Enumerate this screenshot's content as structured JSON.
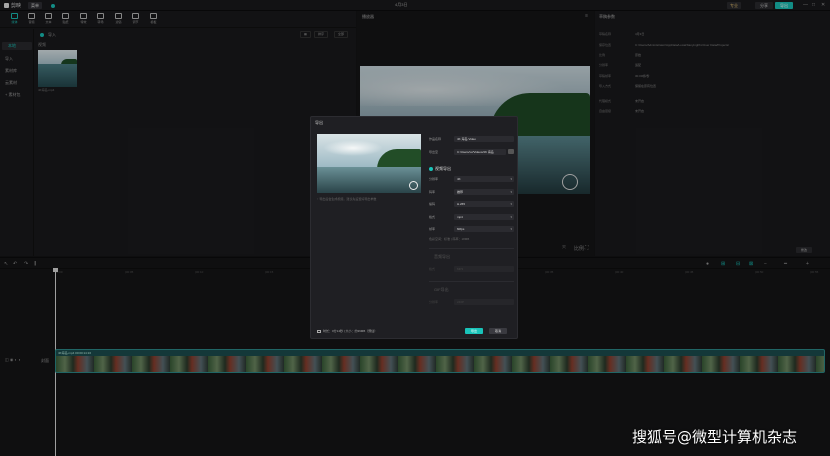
{
  "titlebar": {
    "app_name": "剪映",
    "menu_label": "菜单",
    "project_name": "",
    "center_time": "4月3日",
    "pro_label": "专业",
    "share_label": "分享",
    "export_label": "导出",
    "window_controls": [
      "—",
      "□",
      "✕"
    ]
  },
  "media_panel": {
    "tools": [
      {
        "label": "媒体",
        "icon": "media-icon"
      },
      {
        "label": "音频",
        "icon": "audio-icon"
      },
      {
        "label": "文本",
        "icon": "text-icon"
      },
      {
        "label": "贴纸",
        "icon": "sticker-icon"
      },
      {
        "label": "特效",
        "icon": "effects-icon"
      },
      {
        "label": "转场",
        "icon": "transition-icon"
      },
      {
        "label": "滤镜",
        "icon": "filter-icon"
      },
      {
        "label": "调节",
        "icon": "adjust-icon"
      },
      {
        "label": "模板",
        "icon": "template-icon"
      }
    ],
    "sidebar": [
      "本地",
      "导入",
      "素材库",
      "云素材",
      "+ 素材包"
    ],
    "header_title": "导入",
    "header_buttons": [
      "▦",
      "排序",
      "全部"
    ],
    "subhead": "视频",
    "thumb_caption": "4K海岛.mp4"
  },
  "player": {
    "title": "播放器",
    "ratio_label": "比例"
  },
  "props": {
    "title": "草稿参数",
    "rows": [
      {
        "label": "草稿名称",
        "value": "4月3日"
      },
      {
        "label": "保存位置",
        "value": "C:/Users/Administrator/AppData/Local/JianyingPro/User Data/Projects/"
      },
      {
        "label": "比例",
        "value": "原始"
      },
      {
        "label": "分辨率",
        "value": "适配"
      },
      {
        "label": "草稿帧率",
        "value": "30.00帧/秒"
      },
      {
        "label": "导入方式",
        "value": "保留在原有位置"
      },
      {
        "label": "代理模式",
        "value": "未开启"
      },
      {
        "label": "自由层级",
        "value": "未开启"
      }
    ],
    "modify_label": "修改"
  },
  "timeline": {
    "ruler_marks": [
      "00:00",
      "|00:05",
      "|00:10",
      "|00:15",
      "|00:20",
      "|00:25",
      "|00:30",
      "|00:35",
      "|00:40",
      "|00:45",
      "|00:50",
      "|00:55"
    ],
    "track_label": "封面",
    "clip_name": "4K海岛.mp4  00:00:14:16"
  },
  "dialog": {
    "title": "导出",
    "image_caption": "↑ 导出后会生成视频，建议先设置好导出参数",
    "fields": {
      "name_label": "作品名称",
      "name_value": "4K 海岛 Video",
      "path_label": "导出至",
      "path_value": "C:/Users/xx/Videos/4K 海岛"
    },
    "video_section_label": "视频导出",
    "video_options": [
      {
        "label": "分辨率",
        "value": "4K"
      },
      {
        "label": "码率",
        "value": "推荐"
      },
      {
        "label": "编码",
        "value": "H.265"
      },
      {
        "label": "格式",
        "value": "mp4"
      },
      {
        "label": "帧率",
        "value": "60fps"
      }
    ],
    "estimate": "色彩空间：标准 | 码率：18MB",
    "audio_section_label": "音频导出",
    "audio_option": {
      "label": "格式",
      "value": "MP3"
    },
    "gif_section_label": "GIF导出",
    "gif_option": {
      "label": "分辨率",
      "value": "240P"
    },
    "footer_info": "时长：0分14秒 | 大小：约39MB（预估）",
    "export_button": "导出",
    "cancel_button": "取消"
  },
  "watermark_text": "搜狐号@微型计算机杂志",
  "colors": {
    "accent": "#19c3b9",
    "panel": "#1a1a1d",
    "background": "#141416"
  }
}
